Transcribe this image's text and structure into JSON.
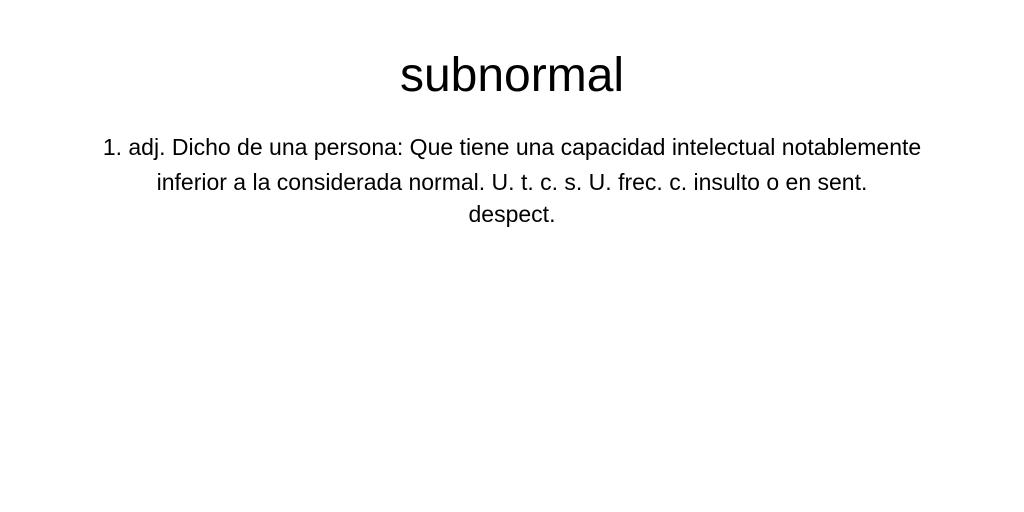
{
  "entry": {
    "term": "subnormal",
    "definition_lines": [
      "1. adj. Dicho de una persona: Que tiene una capacidad intelectual notablemente",
      "inferior a la considerada normal. U. t. c. s. U. frec. c. insulto o en sent.",
      "despect."
    ]
  },
  "colors": {
    "background": "#ffffff",
    "text": "#000000"
  }
}
